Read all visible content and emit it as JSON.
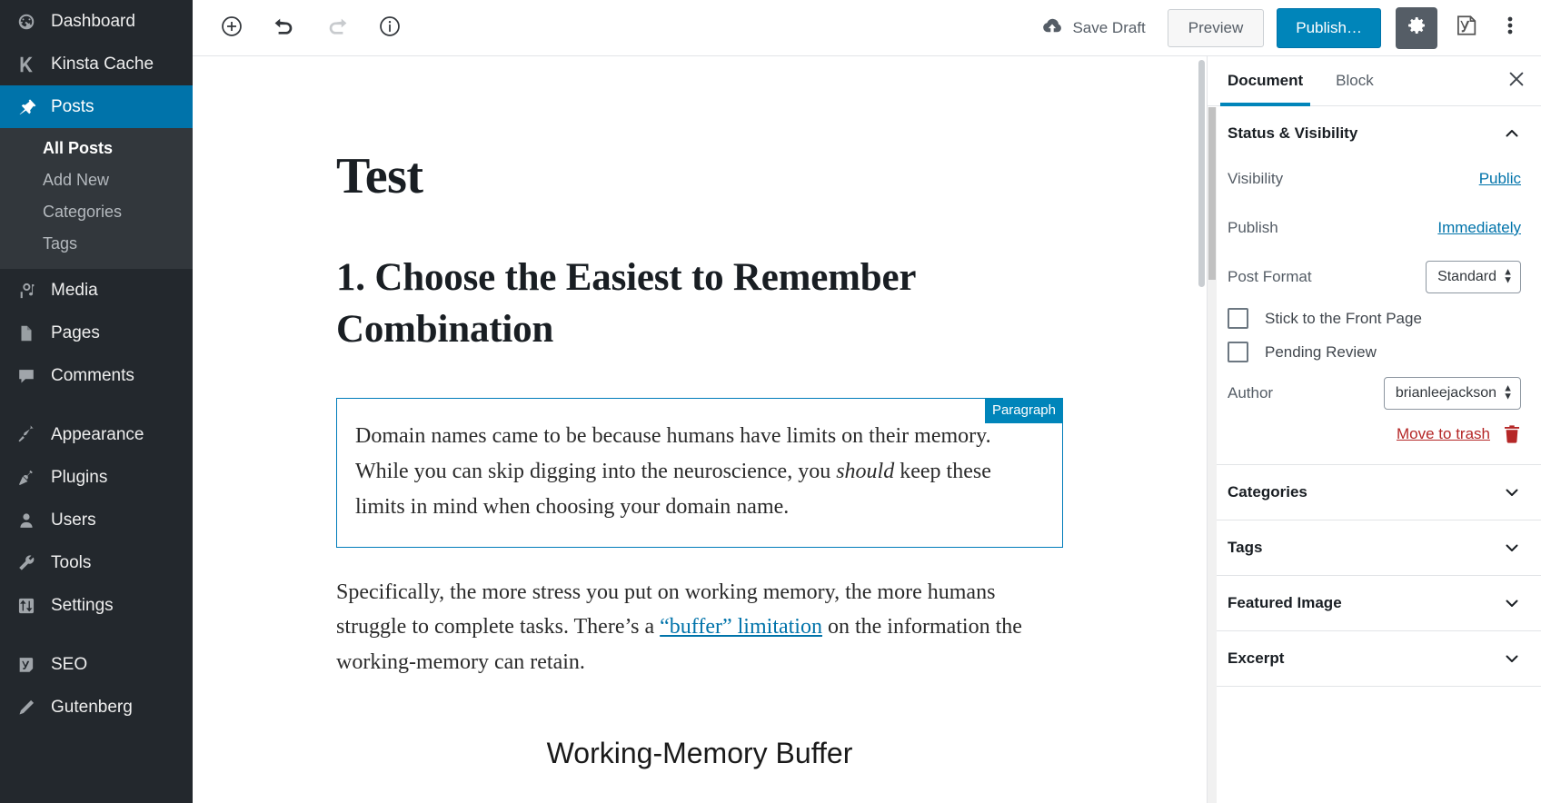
{
  "admin_sidebar": {
    "items": [
      {
        "label": "Dashboard",
        "icon": "dashboard-icon",
        "current": false
      },
      {
        "label": "Kinsta Cache",
        "icon": "kinsta-k-icon",
        "current": false
      },
      {
        "label": "Posts",
        "icon": "pin-icon",
        "current": true
      },
      {
        "label": "Media",
        "icon": "media-icon",
        "current": false
      },
      {
        "label": "Pages",
        "icon": "pages-icon",
        "current": false
      },
      {
        "label": "Comments",
        "icon": "comment-bubble-icon",
        "current": false
      },
      {
        "label": "Appearance",
        "icon": "paintbrush-icon",
        "current": false
      },
      {
        "label": "Plugins",
        "icon": "plug-icon",
        "current": false
      },
      {
        "label": "Users",
        "icon": "user-icon",
        "current": false
      },
      {
        "label": "Tools",
        "icon": "wrench-icon",
        "current": false
      },
      {
        "label": "Settings",
        "icon": "sliders-icon",
        "current": false
      },
      {
        "label": "SEO",
        "icon": "yoast-icon",
        "current": false
      },
      {
        "label": "Gutenberg",
        "icon": "pencil-icon",
        "current": false
      }
    ],
    "posts_submenu": [
      {
        "label": "All Posts",
        "active": true
      },
      {
        "label": "Add New",
        "active": false
      },
      {
        "label": "Categories",
        "active": false
      },
      {
        "label": "Tags",
        "active": false
      }
    ]
  },
  "toolbar": {
    "add_block_icon": "plus-circle-icon",
    "undo_icon": "undo-arrow-icon",
    "redo_icon": "redo-arrow-icon",
    "info_icon": "info-circle-icon",
    "save_draft_label": "Save Draft",
    "save_draft_icon": "cloud-upload-icon",
    "preview_label": "Preview",
    "publish_label": "Publish…",
    "settings_gear_icon": "gear-icon",
    "yoast_icon": "yoast-seo-icon",
    "more_menu_icon": "kebab-menu-icon",
    "accent_blue": "#0085ba",
    "gear_bg": "#555d66"
  },
  "editor": {
    "post_title": "Test",
    "heading": "1. Choose the Easiest to Remember Combination",
    "selected_block": {
      "badge": "Paragraph",
      "text_part1": "Domain names came to be because humans have limits on their memory. While you can skip digging into the neuroscience, you ",
      "text_emphasis": "should",
      "text_part2": " keep these limits in mind when choosing your domain name.",
      "border_color": "#007cba"
    },
    "paragraph2": {
      "part1": "Specifically, the more stress you put on working memory, the more humans struggle to complete tasks. There’s a ",
      "link_text": "“buffer” limitation",
      "part2": " on the information the working-memory can retain."
    },
    "figure_caption": "Working-Memory Buffer"
  },
  "settings": {
    "tabs": [
      {
        "label": "Document",
        "active": true
      },
      {
        "label": "Block",
        "active": false
      }
    ],
    "close_icon": "close-x-icon",
    "panels": [
      {
        "title": "Status & Visibility",
        "expanded": true,
        "chevron": "chevron-up-icon"
      },
      {
        "title": "Categories",
        "expanded": false,
        "chevron": "chevron-down-icon"
      },
      {
        "title": "Tags",
        "expanded": false,
        "chevron": "chevron-down-icon"
      },
      {
        "title": "Featured Image",
        "expanded": false,
        "chevron": "chevron-down-icon"
      },
      {
        "title": "Excerpt",
        "expanded": false,
        "chevron": "chevron-down-icon"
      }
    ],
    "status": {
      "visibility_label": "Visibility",
      "visibility_value": "Public",
      "publish_label": "Publish",
      "publish_value": "Immediately",
      "post_format_label": "Post Format",
      "post_format_value": "Standard",
      "sticky_label": "Stick to the Front Page",
      "sticky_checked": false,
      "pending_label": "Pending Review",
      "pending_checked": false,
      "author_label": "Author",
      "author_value": "brianleejackson",
      "trash_label": "Move to trash",
      "trash_icon": "trash-can-icon",
      "trash_color": "#b52727",
      "link_color": "#0073aa"
    }
  }
}
